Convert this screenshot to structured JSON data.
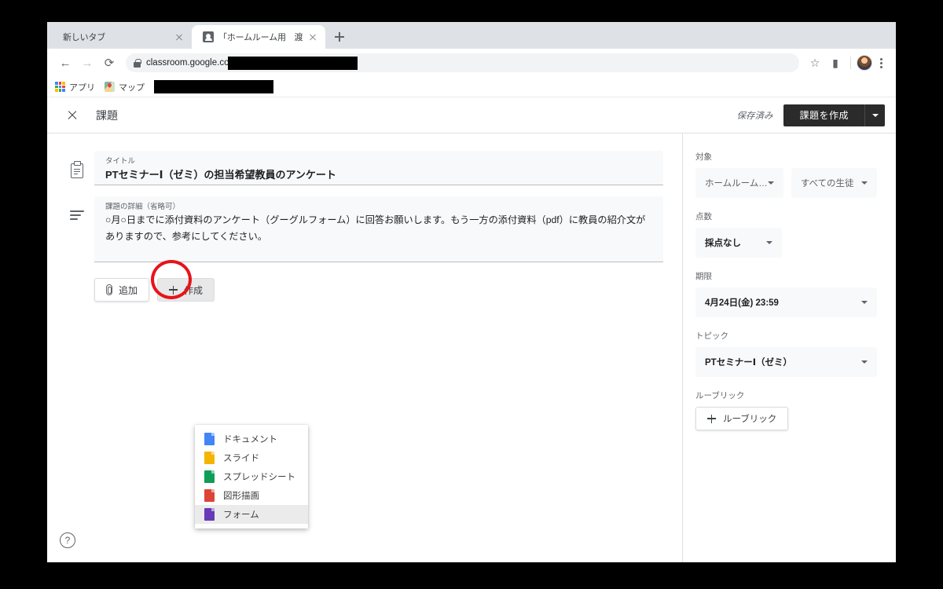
{
  "browser": {
    "tabs": [
      {
        "title": "新しいタブ",
        "active": false,
        "has_favicon": false
      },
      {
        "title": "「ホームルーム用　渡邊クラス（",
        "active": true,
        "has_favicon": true
      }
    ],
    "new_tab_label": "+",
    "toolbar": {
      "back_label": "←",
      "forward_label": "→",
      "reload_label": "⟳",
      "url_text": "classroom.google.co",
      "star_label": "☆",
      "extension_label": "▮",
      "lock_icon": "lock-icon"
    },
    "bookmarks": [
      {
        "label": "アプリ",
        "icon": "apps-grid-icon"
      },
      {
        "label": "マップ",
        "icon": "maps-icon"
      }
    ]
  },
  "header": {
    "close_label": "×",
    "title": "課題",
    "saved_label": "保存済み",
    "primary_button": "課題を作成",
    "primary_caret": "▾"
  },
  "form": {
    "title_field": {
      "label": "タイトル",
      "value": "PTセミナーⅠ（ゼミ）の担当希望教員のアンケート"
    },
    "description_field": {
      "label": "課題の詳細（省略可）",
      "value": "○月○日までに添付資料のアンケート（グーグルフォーム）に回答お願いします。もう一方の添付資料（pdf）に教員の紹介文がありますので、参考にしてください。"
    },
    "attach_button": "追加",
    "create_button": "作成"
  },
  "create_menu": {
    "items": [
      {
        "label": "ドキュメント",
        "icon": "google-docs-icon",
        "color": "#4285f4",
        "active": false
      },
      {
        "label": "スライド",
        "icon": "google-slides-icon",
        "color": "#f4b400",
        "active": false
      },
      {
        "label": "スプレッドシート",
        "icon": "google-sheets-icon",
        "color": "#0f9d58",
        "active": false
      },
      {
        "label": "図形描画",
        "icon": "google-drawings-icon",
        "color": "#db4437",
        "active": false
      },
      {
        "label": "フォーム",
        "icon": "google-forms-icon",
        "color": "#673ab7",
        "active": true
      }
    ]
  },
  "sidebar": {
    "audience": {
      "label": "対象",
      "class_value": "ホームルーム…",
      "students_value": "すべての生徒"
    },
    "points": {
      "label": "点数",
      "value": "採点なし"
    },
    "due": {
      "label": "期限",
      "value": "4月24日(金) 23:59"
    },
    "topic": {
      "label": "トピック",
      "value": "PTセミナーⅠ（ゼミ）"
    },
    "rubric": {
      "label": "ルーブリック",
      "button": "ルーブリック"
    }
  },
  "footer": {
    "help_label": "?"
  },
  "annotation": {
    "type": "red-circle-highlight",
    "target": "create-button",
    "color": "#e8131b"
  }
}
